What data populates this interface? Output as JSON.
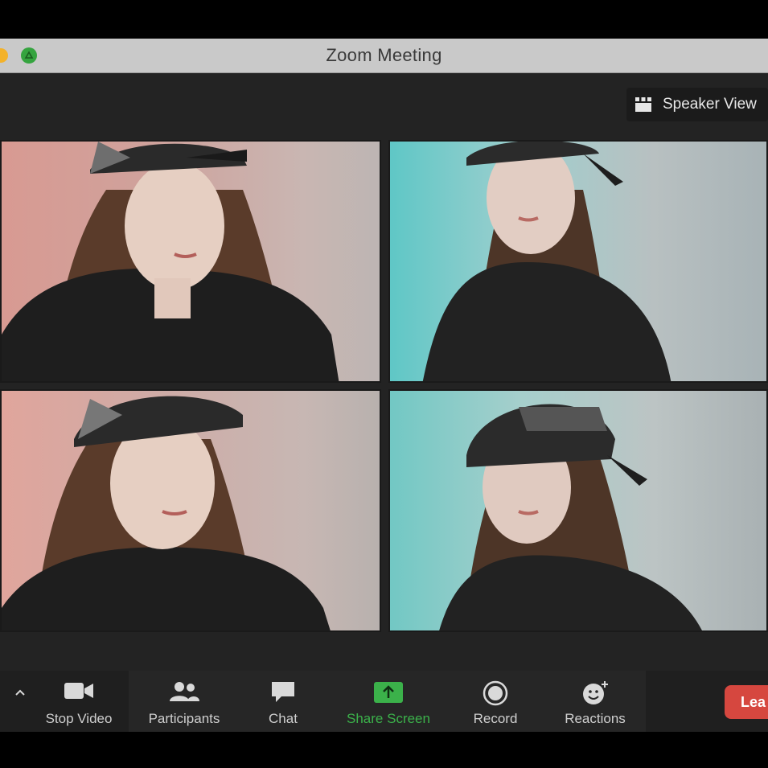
{
  "window": {
    "title": "Zoom Meeting"
  },
  "view": {
    "speaker_view_label": "Speaker View"
  },
  "toolbar": {
    "stop_video": "Stop Video",
    "participants": "Participants",
    "chat": "Chat",
    "share_screen": "Share Screen",
    "record": "Record",
    "reactions": "Reactions",
    "leave": "Lea"
  },
  "colors": {
    "share_green": "#3bb14a",
    "leave_red": "#d6473f",
    "toolbar_bg": "#262626"
  },
  "icons": [
    "video-camera-icon",
    "participants-icon",
    "chat-bubble-icon",
    "share-screen-icon",
    "record-icon",
    "reactions-icon",
    "grid-icon",
    "caret-up-icon"
  ]
}
